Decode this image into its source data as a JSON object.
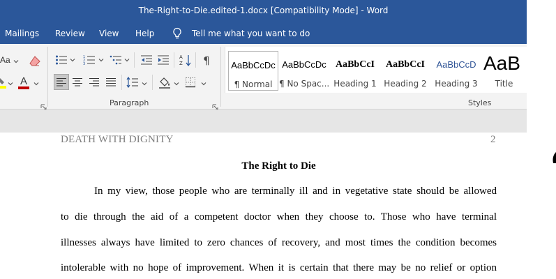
{
  "window": {
    "title": "The-Right-to-Die.edited-1.docx [Compatibility Mode]  -  Word"
  },
  "menu": {
    "tabs": [
      "Mailings",
      "Review",
      "View",
      "Help"
    ],
    "tell_me": "Tell me what you want to do"
  },
  "ribbon": {
    "font_size_label": "Aa",
    "paragraph_label": "Paragraph",
    "styles_label": "Styles",
    "styles": [
      {
        "preview": "AaBbCcDc",
        "name": "¶ Normal"
      },
      {
        "preview": "AaBbCcDc",
        "name": "¶ No Spac..."
      },
      {
        "preview": "AaBbCcI",
        "name": "Heading 1"
      },
      {
        "preview": "AaBbCcI",
        "name": "Heading 2"
      },
      {
        "preview": "AaBbCcD",
        "name": "Heading 3"
      },
      {
        "preview": "AaB",
        "name": "Title"
      }
    ]
  },
  "colors": {
    "titlebar": "#2b579a",
    "font_color_bar": "#c00000",
    "highlight_bar": "#ffff00",
    "heading_preview": "#2f5496"
  },
  "document": {
    "header_left": "DEATH WITH DIGNITY",
    "header_right": "2",
    "title": "The Right to Die",
    "lines": [
      "In my view, those people who are terminally ill and in vegetative state should be allowed",
      "to die through the aid of a competent doctor when they choose to. Those who have terminal",
      "illnesses always have limited to zero chances of recovery, and most times the condition becomes",
      "intolerable with no hope of improvement. When it is certain that there may be no relief or option"
    ]
  }
}
